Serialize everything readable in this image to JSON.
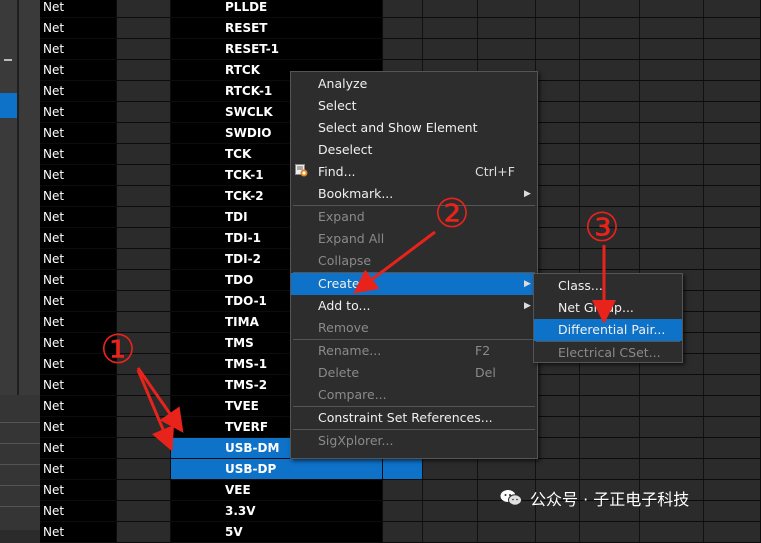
{
  "grid": {
    "rows": [
      {
        "type": "Net",
        "name": "PLLDE",
        "state": "normal"
      },
      {
        "type": "Net",
        "name": "RESET",
        "state": "normal"
      },
      {
        "type": "Net",
        "name": "RESET-1",
        "state": "normal"
      },
      {
        "type": "Net",
        "name": "RTCK",
        "state": "normal"
      },
      {
        "type": "Net",
        "name": "RTCK-1",
        "state": "normal"
      },
      {
        "type": "Net",
        "name": "SWCLK",
        "state": "normal"
      },
      {
        "type": "Net",
        "name": "SWDIO",
        "state": "normal"
      },
      {
        "type": "Net",
        "name": "TCK",
        "state": "normal"
      },
      {
        "type": "Net",
        "name": "TCK-1",
        "state": "normal"
      },
      {
        "type": "Net",
        "name": "TCK-2",
        "state": "normal"
      },
      {
        "type": "Net",
        "name": "TDI",
        "state": "normal"
      },
      {
        "type": "Net",
        "name": "TDI-1",
        "state": "normal"
      },
      {
        "type": "Net",
        "name": "TDI-2",
        "state": "normal"
      },
      {
        "type": "Net",
        "name": "TDO",
        "state": "normal"
      },
      {
        "type": "Net",
        "name": "TDO-1",
        "state": "normal"
      },
      {
        "type": "Net",
        "name": "TIMA",
        "state": "normal"
      },
      {
        "type": "Net",
        "name": "TMS",
        "state": "normal"
      },
      {
        "type": "Net",
        "name": "TMS-1",
        "state": "normal"
      },
      {
        "type": "Net",
        "name": "TMS-2",
        "state": "normal"
      },
      {
        "type": "Net",
        "name": "TVEE",
        "state": "normal"
      },
      {
        "type": "Net",
        "name": "TVERF",
        "state": "normal"
      },
      {
        "type": "Net",
        "name": "USB-DM",
        "state": "selected"
      },
      {
        "type": "Net",
        "name": "USB-DP",
        "state": "selected"
      },
      {
        "type": "Net",
        "name": "VEE",
        "state": "normal"
      },
      {
        "type": "Net",
        "name": "3.3V",
        "state": "normal"
      },
      {
        "type": "Net",
        "name": "5V",
        "state": "normal"
      }
    ]
  },
  "context_menu": {
    "items": [
      {
        "label": "Analyze",
        "enabled": true
      },
      {
        "label": "Select",
        "enabled": true
      },
      {
        "label": "Select and Show Element",
        "enabled": true
      },
      {
        "label": "Deselect",
        "enabled": true
      },
      {
        "label": "Find...",
        "shortcut": "Ctrl+F",
        "enabled": true,
        "icon": "find-icon"
      },
      {
        "label": "Bookmark...",
        "enabled": true,
        "submenu": true
      },
      {
        "label": "Expand",
        "enabled": false
      },
      {
        "label": "Expand All",
        "enabled": false
      },
      {
        "label": "Collapse",
        "enabled": false
      },
      {
        "label": "Create",
        "enabled": true,
        "submenu": true,
        "highlighted": true
      },
      {
        "label": "Add to...",
        "enabled": true,
        "submenu": true
      },
      {
        "label": "Remove",
        "enabled": false
      },
      {
        "label": "Rename...",
        "shortcut": "F2",
        "enabled": false
      },
      {
        "label": "Delete",
        "shortcut": "Del",
        "enabled": false
      },
      {
        "label": "Compare...",
        "enabled": false
      },
      {
        "label": "Constraint Set References...",
        "enabled": true
      },
      {
        "label": "SigXplorer...",
        "enabled": false
      }
    ]
  },
  "create_submenu": {
    "items": [
      {
        "label": "Class...",
        "enabled": true
      },
      {
        "label": "Net Group...",
        "enabled": true
      },
      {
        "label": "Differential Pair...",
        "enabled": true,
        "highlighted": true
      },
      {
        "label": "Electrical CSet...",
        "enabled": false
      }
    ]
  },
  "annotations": {
    "step1": "①",
    "step2": "②",
    "step3": "③",
    "color": "#e8231b"
  },
  "watermark": {
    "text": "公众号 · 子正电子科技",
    "icon": "wechat-icon"
  },
  "colors": {
    "selection": "#0e72c9",
    "menu_bg": "#2d2d2d",
    "grid_bg": "#000000"
  }
}
